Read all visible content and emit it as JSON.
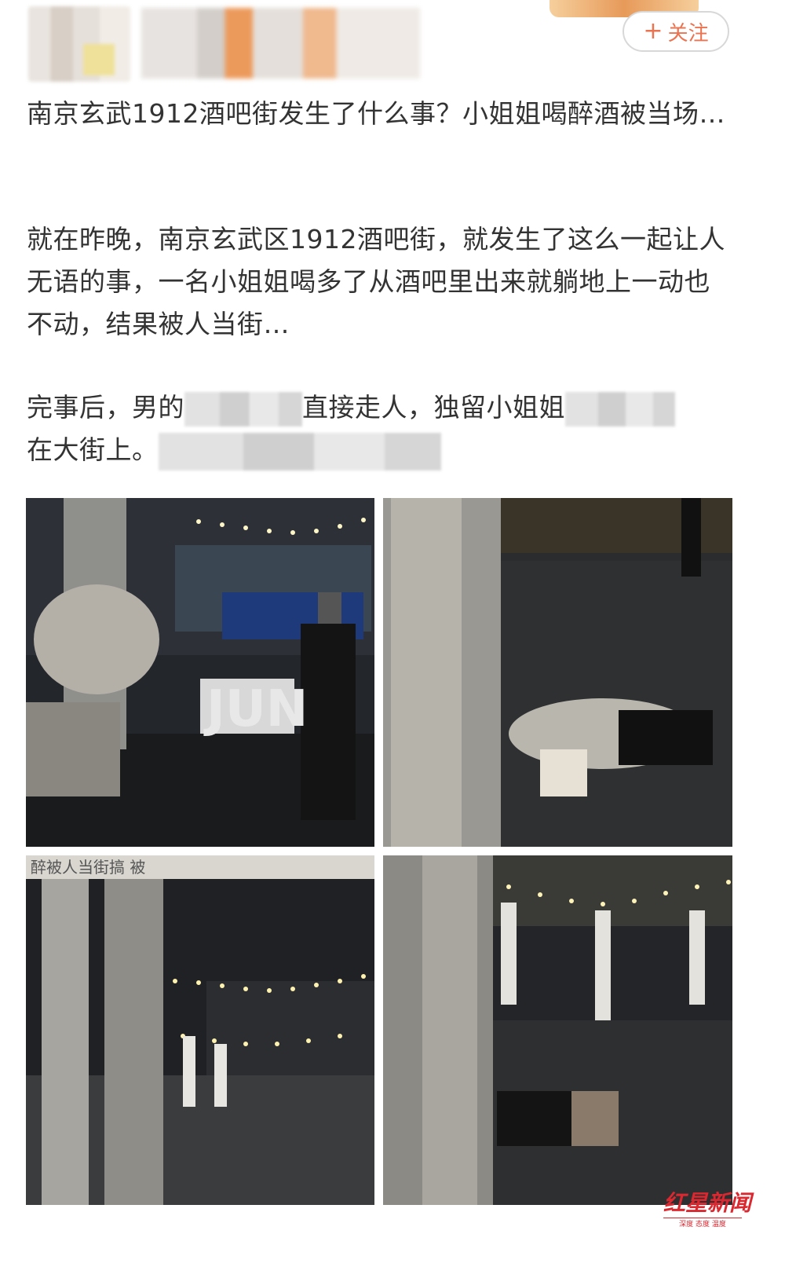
{
  "post": {
    "follow_label": "关注",
    "title_line": "南京玄武1912酒吧街发生了什么事？小姐姐喝醉酒被当场…",
    "para2": "就在昨晚，南京玄武区1912酒吧街，就发生了这么一起让人无语的事，一名小姐姐喝多了从酒吧里出来就躺地上一动也不动，结果被人当街…",
    "para3_a": "完事后，男的",
    "para3_b": "直接走人，独留小姐姐",
    "para3_c": "在大街上。"
  },
  "images": {
    "sign_text": "JUN",
    "photo3_caption": "醉被人当街搞 被"
  },
  "watermark": {
    "title": "红星新闻",
    "subtitle": "深度 态度 温度"
  },
  "colors": {
    "follow": "#eb7350",
    "watermark": "#d9282f"
  }
}
